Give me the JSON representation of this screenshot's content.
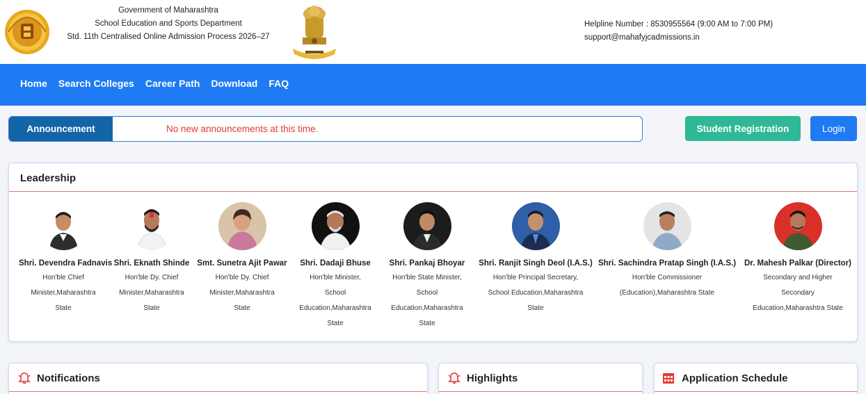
{
  "header": {
    "gov_lines": [
      "Government of Maharashtra",
      "School Education and Sports Department",
      "Std. 11th Centralised Online Admission Process 2026–27"
    ],
    "helpline": "Helpline Number : 8530955564 (9:00 AM to 7:00 PM)",
    "email": "support@mahafyjcadmissions.in"
  },
  "nav": {
    "items": [
      "Home",
      "Search Colleges",
      "Career Path",
      "Download",
      "FAQ"
    ]
  },
  "announcement": {
    "tag": "Announcement",
    "text": "No new announcements at this time."
  },
  "buttons": {
    "register": "Student Registration",
    "login": "Login"
  },
  "leadership": {
    "title": "Leadership",
    "people": [
      {
        "name": "Shri. Devendra Fadnavis",
        "role_lines": [
          "Hon'ble Chief",
          "Minister,Maharashtra",
          "State"
        ]
      },
      {
        "name": "Shri. Eknath Shinde",
        "role_lines": [
          "Hon'ble Dy. Chief",
          "Minister,Maharashtra",
          "State"
        ]
      },
      {
        "name": "Smt. Sunetra Ajit Pawar",
        "role_lines": [
          "Hon'ble Dy. Chief",
          "Minister,Maharashtra",
          "State"
        ]
      },
      {
        "name": "Shri. Dadaji Bhuse",
        "role_lines": [
          "Hon'ble Minister,",
          "School",
          "Education,Maharashtra",
          "State"
        ]
      },
      {
        "name": "Shri. Pankaj Bhoyar",
        "role_lines": [
          "Hon'ble State Minister,",
          "School",
          "Education,Maharashtra",
          "State"
        ]
      },
      {
        "name": "Shri. Ranjit Singh Deol (I.A.S.)",
        "role_lines": [
          "Hon'ble Principal Secretary,",
          "School Education,Maharashtra",
          "State"
        ]
      },
      {
        "name": "Shri. Sachindra Pratap Singh (I.A.S.)",
        "role_lines": [
          "Hon'ble Commissioner",
          "(Education),Maharashtra State"
        ]
      },
      {
        "name": "Dr. Mahesh Palkar (Director)",
        "role_lines": [
          "Secondary and Higher",
          "Secondary",
          "Education,Maharashtra State"
        ]
      }
    ]
  },
  "sections": {
    "notifications": "Notifications",
    "highlights": "Highlights",
    "schedule": "Application Schedule"
  },
  "colors": {
    "nav_blue": "#1e7bf3",
    "announce_tag": "#1464a8",
    "register_green": "#2fb897",
    "alert_red": "#e53935"
  }
}
